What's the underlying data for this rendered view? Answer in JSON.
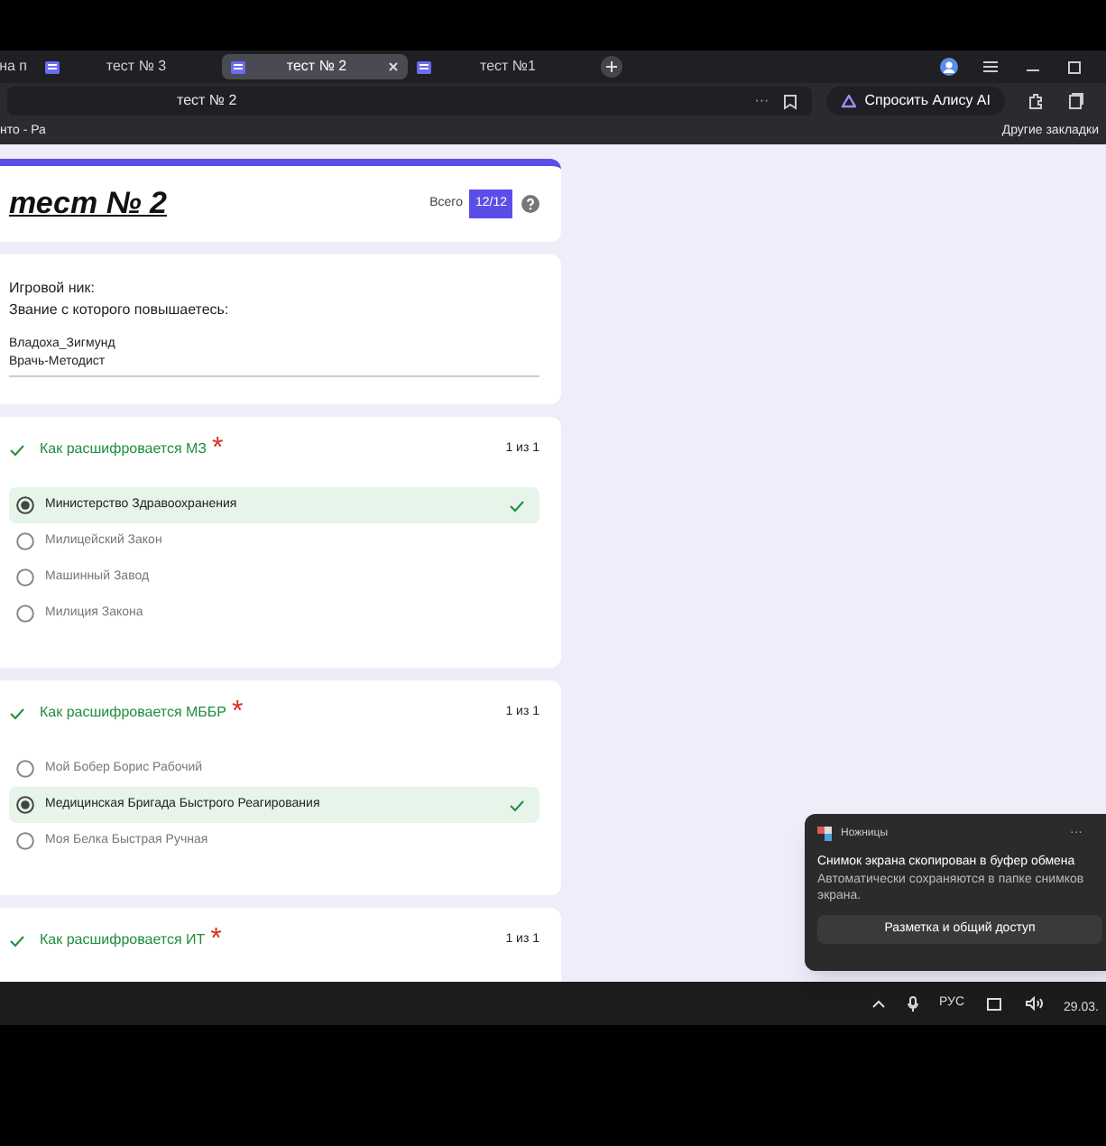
{
  "browser": {
    "tabs": [
      {
        "title": "на п",
        "selected": false
      },
      {
        "title": "тест № 3",
        "selected": false
      },
      {
        "title": "тест № 2",
        "selected": true
      },
      {
        "title": "тест №1",
        "selected": false
      }
    ],
    "address": "тест № 2",
    "address_more": "···",
    "assistant_button": "Спросить Алису AI",
    "bookmarks": [
      "нто - Ра"
    ],
    "other_bookmarks": "Другие закладки"
  },
  "form": {
    "title": "тест № 2",
    "score_label": "Всего",
    "score": "12/12",
    "info": {
      "labels": [
        "Игровой ник:",
        "Звание с которого повышаетесь:"
      ],
      "answers": [
        "Владоха_Зигмунд",
        "Врачь-Методист"
      ]
    },
    "questions": [
      {
        "title": "Как расшифровается МЗ",
        "required_mark": "*",
        "correct": true,
        "points": "1 из 1",
        "options": [
          {
            "label": "Министерство Здравоохранения",
            "selected": true
          },
          {
            "label": "Милицейский Закон",
            "selected": false
          },
          {
            "label": "Машинный Завод",
            "selected": false
          },
          {
            "label": "Милиция Закона",
            "selected": false
          }
        ]
      },
      {
        "title": "Как расшифровается МББР",
        "required_mark": "*",
        "correct": true,
        "points": "1 из 1",
        "options": [
          {
            "label": "Мой Бобер Борис Рабочий",
            "selected": false
          },
          {
            "label": "Медицинская Бригада Быстрого Реагирования",
            "selected": true
          },
          {
            "label": "Моя Белка Быстрая Ручная",
            "selected": false
          }
        ]
      },
      {
        "title": "Как расшифровается ИТ",
        "required_mark": "*",
        "correct": true,
        "points": "1 из 1"
      }
    ]
  },
  "notification": {
    "app": "Ножницы",
    "more": "···",
    "title": "Снимок экрана скопирован в буфер обмена",
    "body": "Автоматически сохраняются в папке снимков экрана.",
    "button": "Разметка и общий доступ"
  },
  "taskbar": {
    "language": "РУС",
    "date": "29.03."
  }
}
